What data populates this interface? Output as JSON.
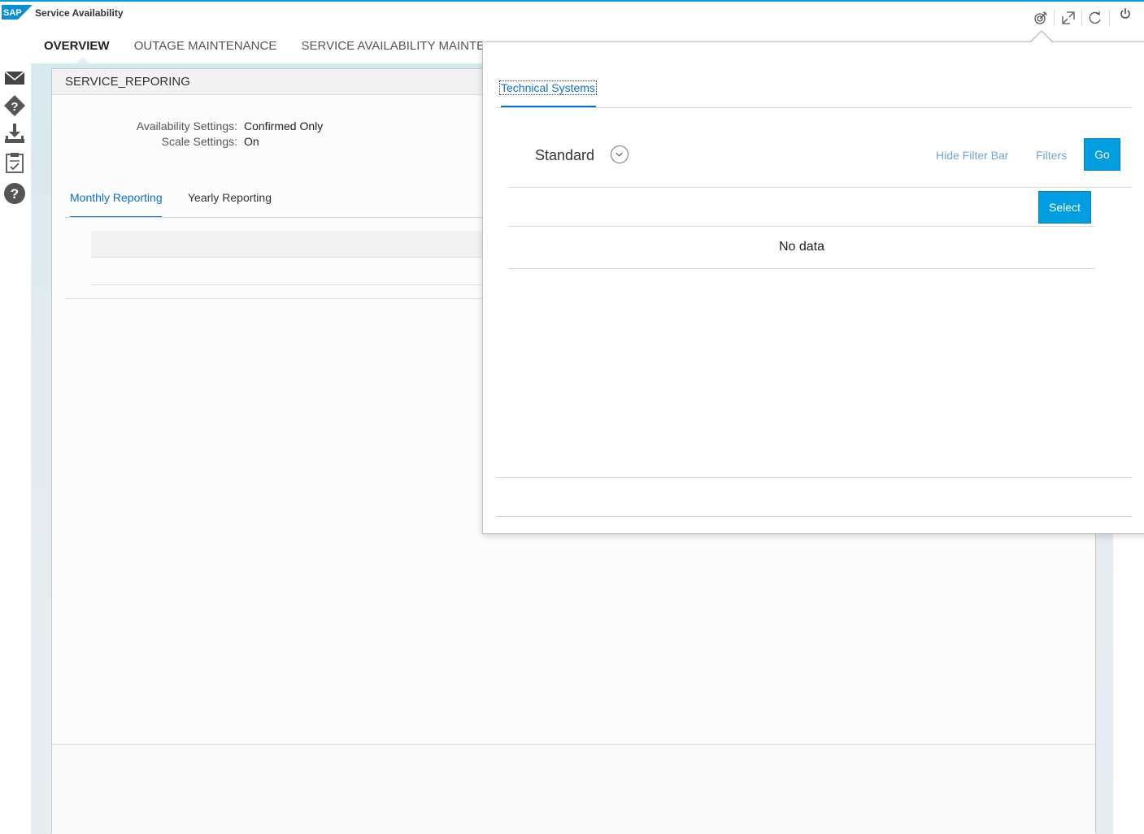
{
  "app": {
    "title": "Service Availability",
    "logo_text": "SAP",
    "brand_color": "#009de0"
  },
  "header_icons": [
    "target-icon",
    "fullscreen-icon",
    "refresh-icon",
    "power-icon"
  ],
  "nav": {
    "tabs": [
      {
        "label": "OVERVIEW",
        "active": true
      },
      {
        "label": "OUTAGE MAINTENANCE",
        "active": false
      },
      {
        "label": "SERVICE AVAILABILITY MAINTEI",
        "active": false
      }
    ]
  },
  "left_toolbar": [
    "mail-icon",
    "help-diamond-icon",
    "download-icon",
    "clipboard-check-icon",
    "help-circle-icon"
  ],
  "card": {
    "title": "SERVICE_REPORING",
    "settings": [
      {
        "label": "Availability Settings:",
        "value": "Confirmed Only"
      },
      {
        "label": "Scale Settings:",
        "value": "On"
      }
    ],
    "tabs": [
      {
        "label": "Monthly Reporting",
        "active": true
      },
      {
        "label": "Yearly Reporting",
        "active": false
      }
    ]
  },
  "popover": {
    "tab": "Technical Systems",
    "variant": "Standard",
    "hide_filter_bar": "Hide Filter Bar",
    "filters": "Filters",
    "go": "Go",
    "select": "Select",
    "no_data": "No data"
  }
}
